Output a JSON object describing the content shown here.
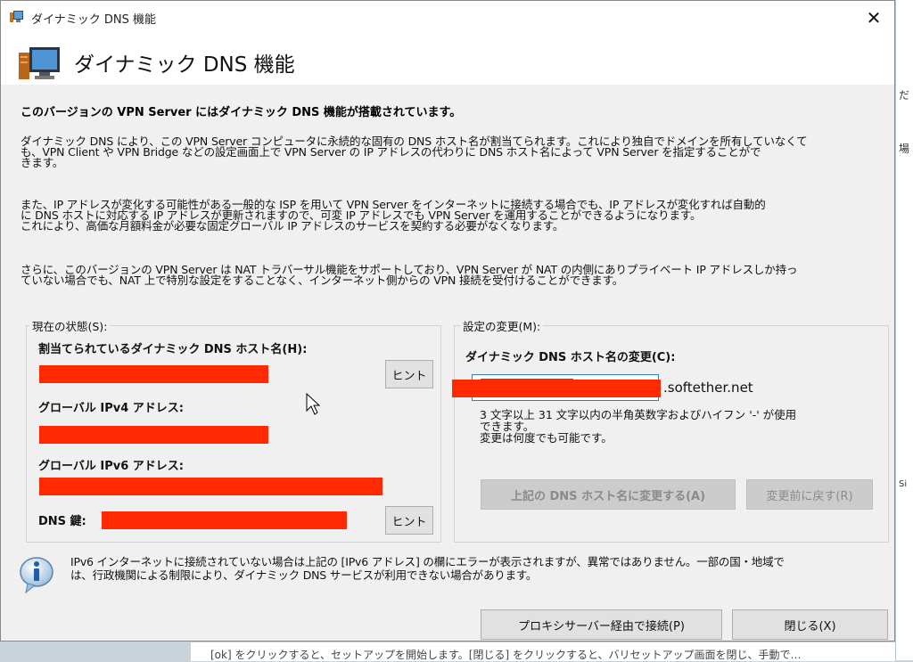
{
  "window": {
    "title": "ダイナミック DNS 機能",
    "close_label": "✕"
  },
  "header": {
    "title": "ダイナミック DNS 機能"
  },
  "content": {
    "intro_bold": "このバージョンの VPN Server にはダイナミック DNS 機能が搭載されています。",
    "paragraph1": [
      "ダイナミック DNS により、この VPN Server コンピュータに永続的な固有の DNS ホスト名が割当てられます。これにより独自でドメインを所有していなくて",
      "も、VPN Client や VPN Bridge などの設定画面上で VPN Server の IP アドレスの代わりに DNS ホスト名によって VPN Server を指定することがで",
      "きます。"
    ],
    "paragraph2": [
      "また、IP アドレスが変化する可能性がある一般的な ISP を用いて VPN Server をインターネットに接続する場合でも、IP アドレスが変化すれば自動的",
      "に DNS ホストに対応する IP アドレスが更新されますので、可変 IP アドレスでも VPN Server を運用することができるようになります。",
      "これにより、高価な月額料金が必要な固定グローバル IP アドレスのサービスを契約する必要がなくなります。"
    ],
    "paragraph3": [
      "さらに、このバージョンの VPN Server は NAT トラバーサル機能をサポートしており、VPN Server が NAT の内側にありプライベート IP アドレスしか持っ",
      "ていない場合でも、NAT 上で特別な設定をすることなく、インターネット側からの VPN 接続を受付けることができます。"
    ]
  },
  "status_group": {
    "label": "現在の状態(S):",
    "hostname_label": "割当てられているダイナミック DNS ホスト名(H):",
    "hint_button": "ヒント",
    "ipv4_label": "グローバル IPv4 アドレス:",
    "ipv6_label": "グローバル IPv6 アドレス:",
    "dns_key_label": "DNS 鍵:",
    "dns_key_hint_button": "ヒント"
  },
  "change_group": {
    "label": "設定の変更(M):",
    "change_label": "ダイナミック DNS ホスト名の変更(C):",
    "domain_suffix": ".softether.net",
    "rule_text": [
      "3 文字以上 31 文字以内の半角英数字およびハイフン '-' が使用",
      "できます。",
      "変更は何度でも可能です。"
    ],
    "apply_button": "上記の DNS ホスト名に変更する(A)",
    "revert_button": "変更前に戻す(R)"
  },
  "note": {
    "text": [
      "IPv6 インターネットに接続されていない場合は上記の [IPv6 アドレス] の欄にエラーが表示されますが、異常ではありません。一部の国・地域で",
      "は、行政機関による制限により、ダイナミック DNS サービスが利用できない場合があります。"
    ]
  },
  "footer": {
    "proxy_button": "プロキシサーバー経由で接続(P)",
    "close_button": "閉じる(X)"
  },
  "background": {
    "bottom_text": "[ok] をクリックすると、セットアップを開始します。[閉じる] をクリックすると、バリセットアップ画面を閉じ、手動で…",
    "right_marks": [
      "だ",
      "場",
      "Si"
    ]
  }
}
